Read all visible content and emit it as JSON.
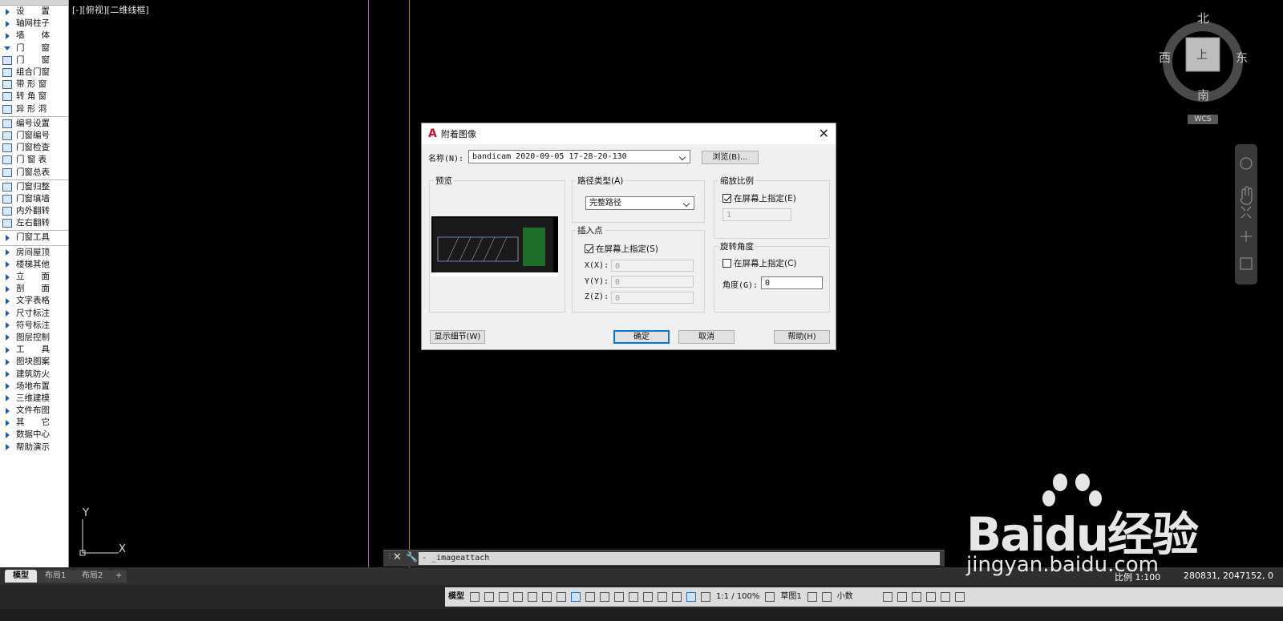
{
  "viewport": {
    "label": "[-][俯视][二维线框]",
    "ucs_y": "Y",
    "ucs_x": "X"
  },
  "sidebar": {
    "items": [
      {
        "label": "设　　置",
        "type": "group"
      },
      {
        "label": "轴网柱子",
        "type": "group"
      },
      {
        "label": "墙　　体",
        "type": "group"
      },
      {
        "label": "门　　窗",
        "type": "group-open"
      },
      {
        "label": "门　　窗",
        "type": "sub"
      },
      {
        "label": "组合门窗",
        "type": "sub"
      },
      {
        "label": "带 形 窗",
        "type": "sub"
      },
      {
        "label": "转 角 窗",
        "type": "sub"
      },
      {
        "label": "异 形 洞",
        "type": "sub"
      },
      {
        "label": "编号设置",
        "type": "sub"
      },
      {
        "label": "门窗编号",
        "type": "sub"
      },
      {
        "label": "门窗检查",
        "type": "sub"
      },
      {
        "label": "门 窗 表",
        "type": "sub"
      },
      {
        "label": "门窗总表",
        "type": "sub"
      },
      {
        "label": "门窗归整",
        "type": "sub"
      },
      {
        "label": "门窗填墙",
        "type": "sub"
      },
      {
        "label": "内外翻转",
        "type": "sub"
      },
      {
        "label": "左右翻转",
        "type": "sub"
      },
      {
        "label": "门窗工具",
        "type": "group"
      },
      {
        "label": "房间屋顶",
        "type": "group"
      },
      {
        "label": "楼梯其他",
        "type": "group"
      },
      {
        "label": "立　　面",
        "type": "group"
      },
      {
        "label": "剖　　面",
        "type": "group"
      },
      {
        "label": "文字表格",
        "type": "group"
      },
      {
        "label": "尺寸标注",
        "type": "group"
      },
      {
        "label": "符号标注",
        "type": "group"
      },
      {
        "label": "图层控制",
        "type": "group"
      },
      {
        "label": "工　　具",
        "type": "group"
      },
      {
        "label": "图块图案",
        "type": "group"
      },
      {
        "label": "建筑防火",
        "type": "group"
      },
      {
        "label": "场地布置",
        "type": "group"
      },
      {
        "label": "三维建模",
        "type": "group"
      },
      {
        "label": "文件布图",
        "type": "group"
      },
      {
        "label": "其　　它",
        "type": "group"
      },
      {
        "label": "数据中心",
        "type": "group"
      },
      {
        "label": "帮助演示",
        "type": "group"
      }
    ]
  },
  "viewcube": {
    "north": "北",
    "south": "南",
    "east": "东",
    "west": "西",
    "top": "上",
    "wcs": "WCS"
  },
  "dialog": {
    "title": "附着图像",
    "name_label": "名称(N):",
    "name_value": "bandicam 2020-09-05 17-28-20-130",
    "browse": "浏览(B)...",
    "preview_label": "预览",
    "path_type_label": "路径类型(A)",
    "path_type_value": "完整路径",
    "insert_label": "插入点",
    "insert_onscreen": "在屏幕上指定(S)",
    "x_label": "X(X):",
    "x_value": "0",
    "y_label": "Y(Y):",
    "y_value": "0",
    "z_label": "Z(Z):",
    "z_value": "0",
    "scale_label": "缩放比例",
    "scale_onscreen": "在屏幕上指定(E)",
    "scale_value": "1",
    "rotation_label": "旋转角度",
    "rotation_onscreen": "在屏幕上指定(C)",
    "angle_label": "角度(G):",
    "angle_value": "0",
    "details": "显示细节(W)",
    "ok": "确定",
    "cancel": "取消",
    "help": "帮助(H)"
  },
  "command": {
    "text": "- _imageattach"
  },
  "tabs": [
    "模型",
    "布局1",
    "布局2",
    "+"
  ],
  "status": {
    "model": "模型",
    "scale": "1:1 / 100%",
    "sketch": "草图1",
    "decimal": "小数",
    "scale_readout": "比例 1:100",
    "coords": "280831, 2047152, 0"
  },
  "watermark": {
    "brand": "Baidu经验",
    "url": "jingyan.baidu.com"
  }
}
